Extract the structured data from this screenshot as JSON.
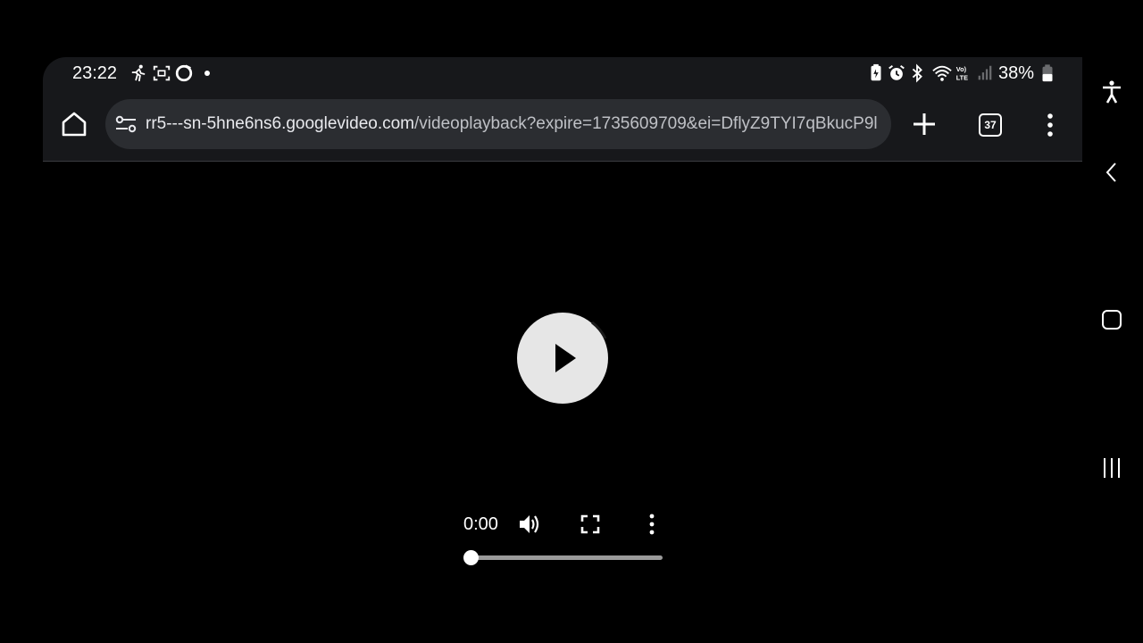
{
  "status_bar": {
    "time": "23:22",
    "battery_percent": "38%",
    "icons_left": [
      "running-icon",
      "screen-record-icon",
      "circle-app-icon",
      "notification-dot"
    ],
    "icons_right": [
      "battery-saver-icon",
      "alarm-icon",
      "bluetooth-icon",
      "wifi-icon",
      "volte-icon",
      "signal-icon",
      "battery-icon"
    ]
  },
  "browser": {
    "url_host": "rr5---sn-5hne6ns6.googlevideo.com",
    "url_path": "/videoplayback?expire=1735609709&ei=DflyZ9TYI7qBkucP9l",
    "tab_count": "37",
    "icons": [
      "home-icon",
      "site-settings-icon",
      "new-tab-plus-icon",
      "tab-switcher-icon",
      "more-menu-icon"
    ]
  },
  "video_player": {
    "current_time": "0:00",
    "progress": 0.0,
    "controls": [
      "play-icon",
      "volume-icon",
      "fullscreen-icon",
      "more-options-icon"
    ]
  },
  "system_nav": {
    "buttons": [
      "accessibility-icon",
      "back-icon",
      "home-square-icon",
      "recents-icon"
    ]
  },
  "colors": {
    "toolbar_bg": "#17181b",
    "urlbar_bg": "#2b2d31",
    "page_bg": "#000000",
    "play_button": "#e6e6e6"
  }
}
